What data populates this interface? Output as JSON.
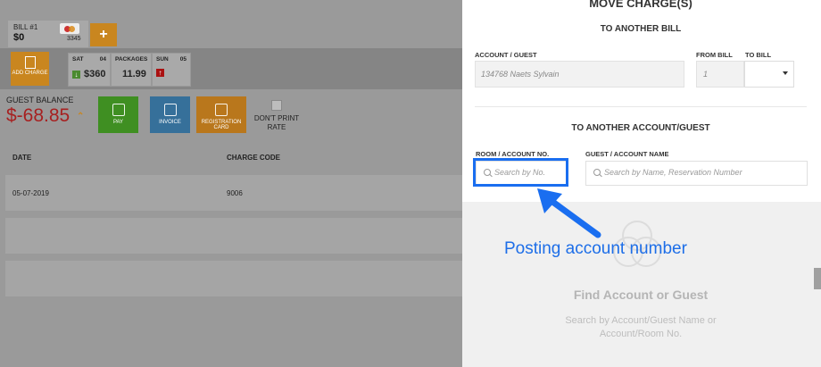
{
  "bill": {
    "label": "BILL #1",
    "amount": "$0",
    "card_last": "3345",
    "add_label": "+"
  },
  "add_charge": {
    "label": "ADD CHARGE"
  },
  "days": [
    {
      "day": "SAT",
      "date": "04",
      "value": "$360"
    },
    {
      "day": "PACKAGES",
      "date": "",
      "value": "11.99"
    },
    {
      "day": "SUN",
      "date": "05",
      "value": ""
    }
  ],
  "guest_balance": {
    "label": "GUEST BALANCE",
    "amount": "$-68.85"
  },
  "actions": {
    "pay": "PAY",
    "invoice": "INVOICE",
    "registration": "REGISTRATION CARD",
    "dont_print": "DON'T PRINT RATE"
  },
  "table": {
    "headers": [
      "DATE",
      "CHARGE CODE"
    ],
    "rows": [
      {
        "date": "05-07-2019",
        "code": "9006"
      }
    ]
  },
  "panel": {
    "title": "MOVE CHARGE(S)",
    "section1": "TO ANOTHER BILL",
    "account_label": "ACCOUNT / GUEST",
    "account_value": "134768 Naets Sylvain",
    "from_label": "FROM BILL",
    "from_value": "1",
    "to_label": "TO BILL",
    "section2": "TO ANOTHER ACCOUNT/GUEST",
    "room_label": "ROOM / ACCOUNT NO.",
    "room_placeholder": "Search by No.",
    "guest_label": "GUEST / ACCOUNT NAME",
    "guest_placeholder": "Search by Name, Reservation Number",
    "find_title": "Find Account or Guest",
    "find_text": "Search by Account/Guest Name or Account/Room No."
  },
  "annotation": {
    "text": "Posting account number",
    "color": "#1d6ee8"
  },
  "colors": {
    "balance": "#a72020",
    "pay": "#3f8f22",
    "invoice": "#36709a",
    "accent": "#c9861f"
  }
}
